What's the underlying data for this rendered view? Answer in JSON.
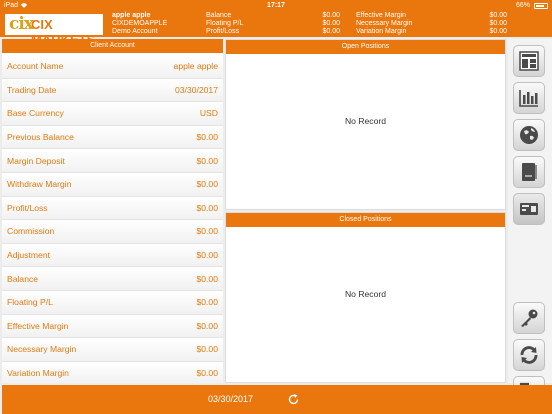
{
  "statusbar": {
    "device": "iPad",
    "time": "17:17",
    "battery": "66%"
  },
  "header": {
    "logo_text": "CIX MARKETS",
    "account": [
      "apple apple",
      "CIXDEMOAPPLE",
      "Demo Account"
    ],
    "col1_labels": [
      "Balance",
      "Floating P/L",
      "Profit/Loss"
    ],
    "col1_values": [
      "$0.00",
      "$0.00",
      "$0.00"
    ],
    "col2_labels": [
      "Effective Margin",
      "Necessary Margin",
      "Variation Margin"
    ],
    "col2_values": [
      "$0.00",
      "$0.00",
      "$0.00"
    ]
  },
  "client_account": {
    "title": "Client Account",
    "rows": [
      {
        "label": "Account Name",
        "value": "apple apple"
      },
      {
        "label": "Trading Date",
        "value": "03/30/2017"
      },
      {
        "label": "Base Currency",
        "value": "USD"
      },
      {
        "label": "Previous Balance",
        "value": "$0.00"
      },
      {
        "label": "Margin Deposit",
        "value": "$0.00"
      },
      {
        "label": "Withdraw Margin",
        "value": "$0.00"
      },
      {
        "label": "Profit/Loss",
        "value": "$0.00"
      },
      {
        "label": "Commission",
        "value": "$0.00"
      },
      {
        "label": "Adjustment",
        "value": "$0.00"
      },
      {
        "label": "Balance",
        "value": "$0.00"
      },
      {
        "label": "Floating P/L",
        "value": "$0.00"
      },
      {
        "label": "Effective Margin",
        "value": "$0.00"
      },
      {
        "label": "Necessary Margin",
        "value": "$0.00"
      },
      {
        "label": "Variation Margin",
        "value": "$0.00"
      }
    ]
  },
  "open_positions": {
    "title": "Open Positions",
    "empty_text": "No Record"
  },
  "closed_positions": {
    "title": "Closed Positions",
    "empty_text": "No Record"
  },
  "toolbar": {
    "buttons": [
      "dashboard-icon",
      "chart-icon",
      "globe-icon",
      "ledger-icon",
      "statement-icon",
      "key-icon",
      "refresh-icon",
      "logout-icon"
    ]
  },
  "footer": {
    "date": "03/30/2017"
  },
  "colors": {
    "accent": "#e9770d",
    "text_accent": "#e07a10"
  }
}
